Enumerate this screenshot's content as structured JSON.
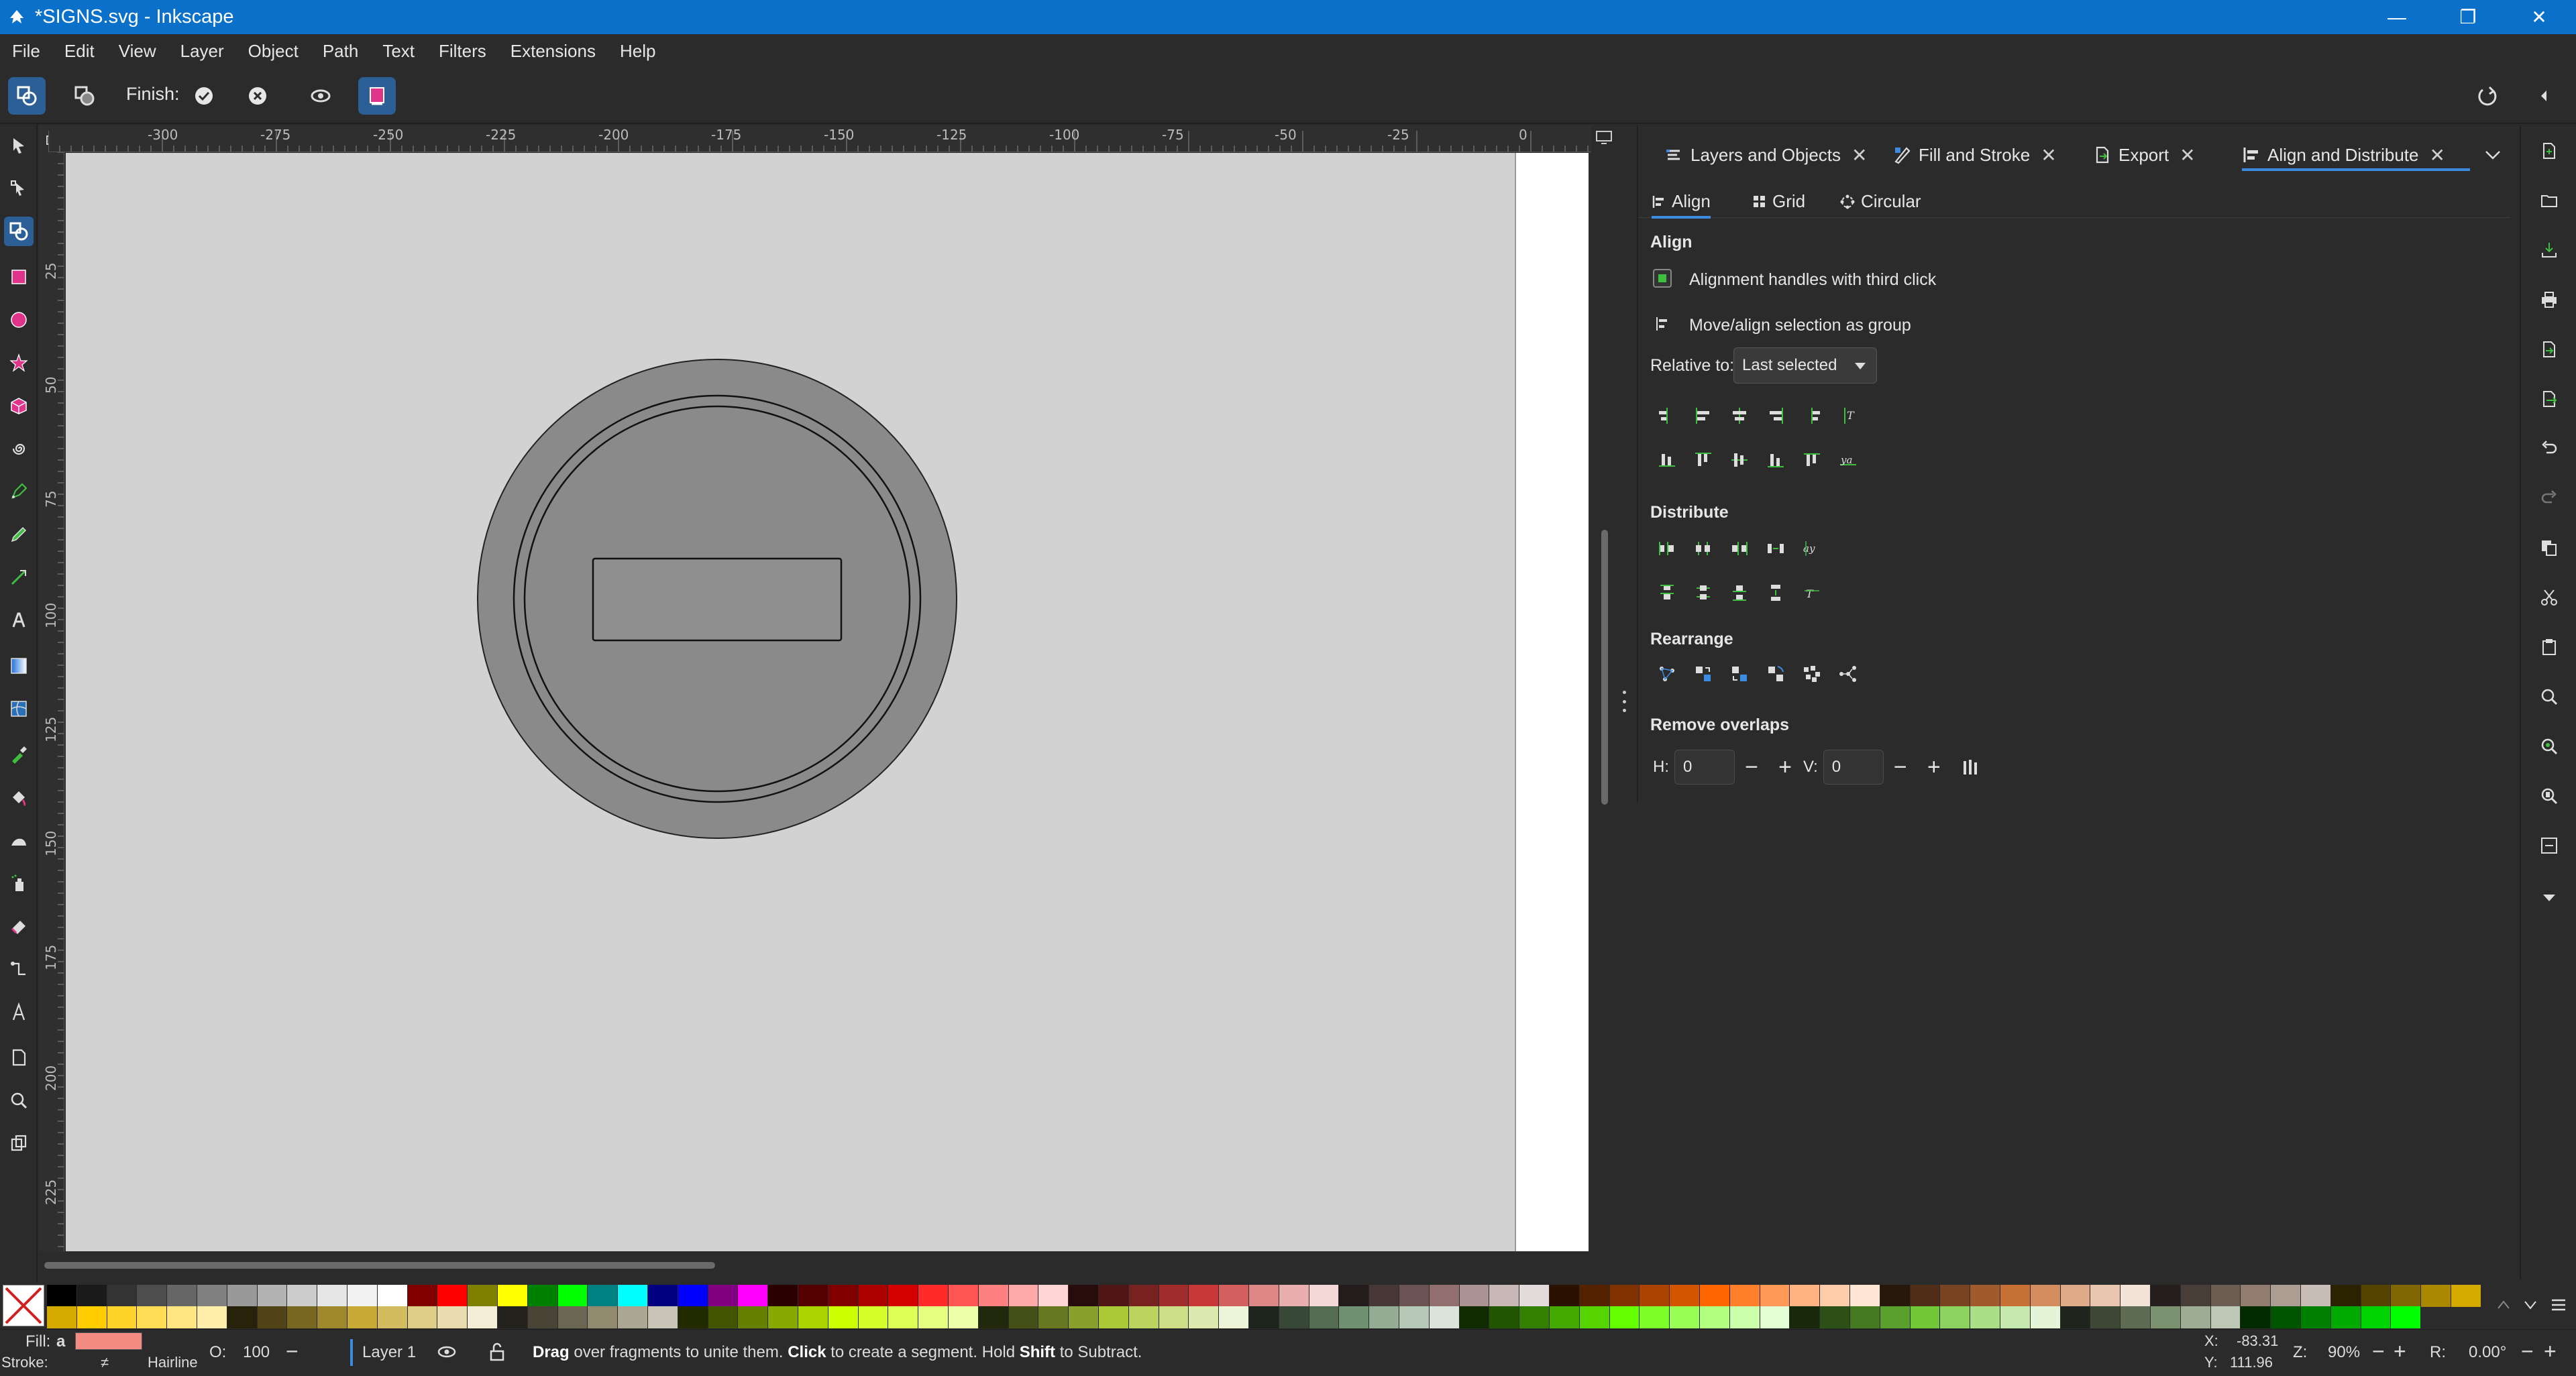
{
  "window": {
    "title": "*SIGNS.svg - Inkscape",
    "minimize_glyph": "—",
    "maximize_glyph": "❐",
    "close_glyph": "✕"
  },
  "menu": [
    "File",
    "Edit",
    "View",
    "Layer",
    "Object",
    "Path",
    "Text",
    "Filters",
    "Extensions",
    "Help"
  ],
  "tool_controls": {
    "finish_label": "Finish:",
    "confirm_glyph": "✔",
    "cancel_glyph": "✕"
  },
  "rulers": {
    "horizontal": [
      "-300",
      "-275",
      "-250",
      "-225",
      "-200",
      "-175",
      "-150",
      "-125",
      "-100",
      "-75",
      "-50",
      "-25",
      "0"
    ],
    "vertical": [
      "25",
      "50",
      "75",
      "100",
      "125",
      "150",
      "175",
      "200",
      "225"
    ]
  },
  "dock": {
    "tabs": [
      {
        "label": "Layers and Objects",
        "icon": "layers-icon"
      },
      {
        "label": "Fill and Stroke",
        "icon": "fill-stroke-icon"
      },
      {
        "label": "Export",
        "icon": "export-icon"
      },
      {
        "label": "Align and Distribute",
        "icon": "align-icon"
      }
    ],
    "close_glyph": "✕",
    "subtabs": [
      "Align",
      "Grid",
      "Circular"
    ],
    "align_heading": "Align",
    "alignment_handles_label": "Alignment handles with third click",
    "move_group_label": "Move/align selection as group",
    "relative_to_label": "Relative to:",
    "relative_to_value": "Last selected",
    "distribute_heading": "Distribute",
    "rearrange_heading": "Rearrange",
    "remove_overlaps_heading": "Remove overlaps",
    "h_label": "H:",
    "h_value": "0",
    "v_label": "V:",
    "v_value": "0",
    "minus": "−",
    "plus": "+"
  },
  "status": {
    "fill_label": "Fill:",
    "fill_value": "a",
    "fill_color": "#f28b82",
    "stroke_label": "Stroke:",
    "stroke_value": "≠",
    "stroke_width": "Hairline",
    "opacity_label": "O:",
    "opacity_value": "100",
    "layer_name": "Layer 1",
    "message_drag": "Drag",
    "message_1": " over fragments to unite them. ",
    "message_click": "Click",
    "message_2": " to create a segment. Hold ",
    "message_shift": "Shift",
    "message_3": " to Subtract.",
    "x_label": "X:",
    "x_value": "-83.31",
    "y_label": "Y:",
    "y_value": "111.96",
    "zoom_label": "Z:",
    "zoom_value": "90%",
    "rotation_label": "R:",
    "rotation_value": "0.00°"
  },
  "palette": {
    "row1": [
      "#000000",
      "#1a1a1a",
      "#333333",
      "#4d4d4d",
      "#666666",
      "#808080",
      "#999999",
      "#b3b3b3",
      "#cccccc",
      "#e6e6e6",
      "#f2f2f2",
      "#ffffff",
      "#800000",
      "#ff0000",
      "#808000",
      "#ffff00",
      "#008000",
      "#00ff00",
      "#008080",
      "#00ffff",
      "#000080",
      "#0000ff",
      "#800080",
      "#ff00ff",
      "#2b0000",
      "#550000",
      "#800000",
      "#aa0000",
      "#d40000",
      "#ff2a2a",
      "#ff5555",
      "#ff8080",
      "#ffaaaa",
      "#ffd5d5",
      "#280b0b",
      "#501616",
      "#782121",
      "#a02c2c",
      "#c83737",
      "#d35f5f",
      "#de8787",
      "#e9afaf",
      "#f4d7d7",
      "#241c1c",
      "#483737",
      "#6c5353",
      "#916f6f",
      "#ac9393",
      "#c8b7b7",
      "#e3dbdb",
      "#2b1100",
      "#552200",
      "#803300",
      "#aa4400",
      "#d45500",
      "#ff6600",
      "#ff7f2a",
      "#ff9955",
      "#ffb380",
      "#ffccaa",
      "#ffe6d5",
      "#28170b",
      "#502d16",
      "#784421",
      "#a05a2c",
      "#c87137",
      "#d38d5f",
      "#deaa87",
      "#e9c6af",
      "#f4e3d7",
      "#241f1c",
      "#483e37",
      "#6c5d53",
      "#917c6f",
      "#ac9d93",
      "#c8beb7",
      "#2b2200",
      "#554400",
      "#806600",
      "#aa8800",
      "#d4aa00"
    ],
    "row2": [
      "#d4aa00",
      "#ffcc00",
      "#ffd42a",
      "#ffdd55",
      "#ffe680",
      "#ffeeaa",
      "#28220b",
      "#504416",
      "#786721",
      "#a0892c",
      "#c8ab37",
      "#d3bc5f",
      "#decd87",
      "#e9ddaf",
      "#f4eed7",
      "#24221c",
      "#484537",
      "#6c6753",
      "#918a6f",
      "#aca793",
      "#c8c4b7",
      "#222b00",
      "#445500",
      "#668000",
      "#88aa00",
      "#aad400",
      "#ccff00",
      "#d4ff2a",
      "#ddff55",
      "#e5ff80",
      "#eeffaa",
      "#22280b",
      "#445016",
      "#677821",
      "#89a02c",
      "#abc837",
      "#bcd35f",
      "#cdde87",
      "#dde9af",
      "#eef4d7",
      "#1c241c",
      "#374837",
      "#536c53",
      "#6f916f",
      "#93ac93",
      "#b7c8b7",
      "#dbe3db",
      "#112b00",
      "#225500",
      "#338000",
      "#44aa00",
      "#55d400",
      "#66ff00",
      "#7fff2a",
      "#99ff55",
      "#b3ff80",
      "#ccffaa",
      "#e5ffd5",
      "#17280b",
      "#2d5016",
      "#447821",
      "#5aa02c",
      "#71c837",
      "#8dd35f",
      "#aade87",
      "#c6e9af",
      "#e3f4d7",
      "#1f241c",
      "#3e4837",
      "#5d6c53",
      "#7c916f",
      "#9dac93",
      "#bec8b7",
      "#002b00",
      "#005500",
      "#008000",
      "#00aa00",
      "#00d400",
      "#00ff00"
    ]
  }
}
